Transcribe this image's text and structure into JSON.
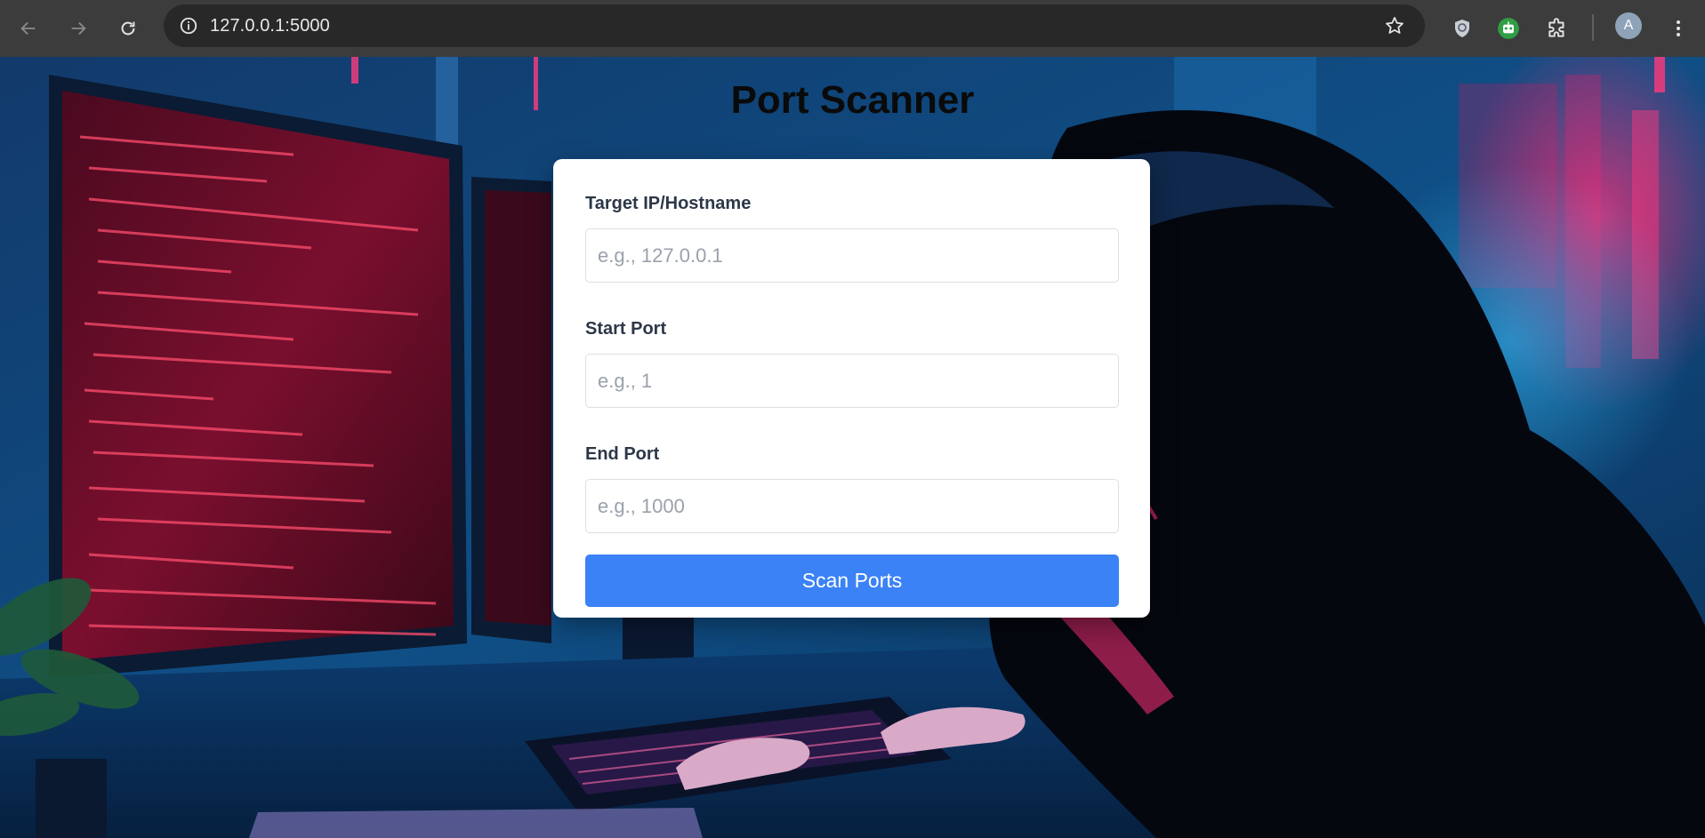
{
  "browser": {
    "url": "127.0.0.1:5000",
    "profile_initial": "A",
    "icons": {
      "back": "arrow-left-icon",
      "forward": "arrow-right-icon",
      "reload": "reload-icon",
      "site_info": "info-icon",
      "bookmark": "star-icon",
      "extension_1": "shield-extension-icon",
      "extension_2": "robot-extension-icon",
      "extensions": "puzzle-icon",
      "menu": "kebab-menu-icon"
    }
  },
  "page": {
    "title": "Port Scanner",
    "background_image": "hooded hacker at computer monitors with red code, neon blue and pink city lights"
  },
  "form": {
    "target": {
      "label": "Target IP/Hostname",
      "placeholder": "e.g., 127.0.0.1",
      "value": ""
    },
    "start_port": {
      "label": "Start Port",
      "placeholder": "e.g., 1",
      "value": ""
    },
    "end_port": {
      "label": "End Port",
      "placeholder": "e.g., 1000",
      "value": ""
    },
    "submit_label": "Scan Ports"
  },
  "colors": {
    "chrome_bg": "#3c3c3c",
    "omnibox_bg": "#282828",
    "button_bg": "#3b82f6",
    "card_bg": "#ffffff",
    "title": "#0a0a0a"
  }
}
